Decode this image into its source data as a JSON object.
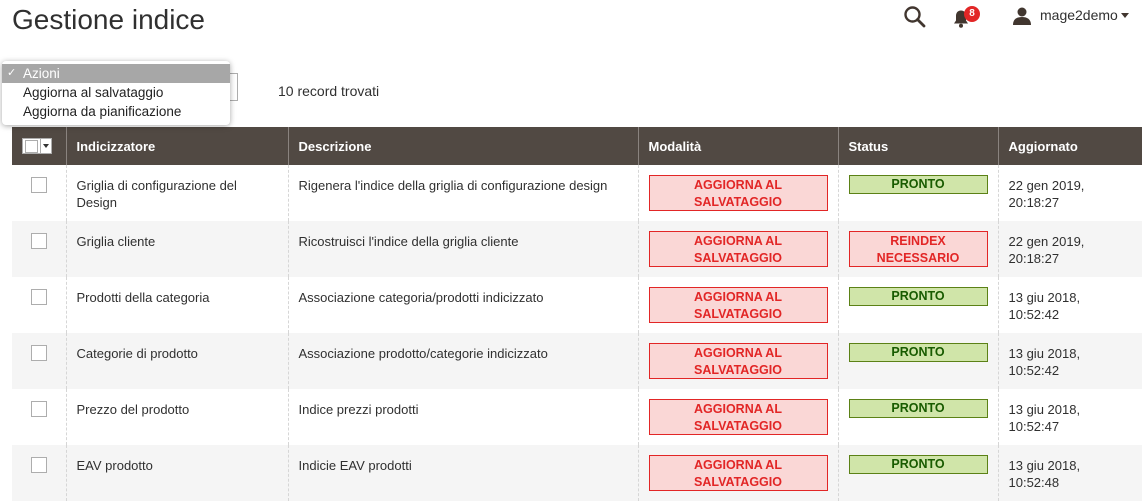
{
  "page": {
    "title": "Gestione indice"
  },
  "header": {
    "notifications_count": "8",
    "username": "mage2demo"
  },
  "actions_select": {
    "options": [
      "Azioni",
      "Aggiorna al salvataggio",
      "Aggiorna da pianificazione"
    ],
    "selected": "Azioni",
    "checkmark": "✓"
  },
  "records_found": "10 record trovati",
  "grid": {
    "columns": [
      "Indicizzatore",
      "Descrizione",
      "Modalità",
      "Status",
      "Aggiornato"
    ],
    "rows": [
      {
        "indexer": "Griglia di configurazione del Design",
        "description": "Rigenera l'indice della griglia di configurazione design",
        "mode": "AGGIORNA AL SALVATAGGIO",
        "status": "PRONTO",
        "status_type": "ok",
        "updated": "22 gen 2019, 20:18:27"
      },
      {
        "indexer": "Griglia cliente",
        "description": "Ricostruisci l'indice della griglia cliente",
        "mode": "AGGIORNA AL SALVATAGGIO",
        "status": "REINDEX NECESSARIO",
        "status_type": "critical",
        "updated": "22 gen 2019, 20:18:27"
      },
      {
        "indexer": "Prodotti della categoria",
        "description": "Associazione categoria/prodotti indicizzato",
        "mode": "AGGIORNA AL SALVATAGGIO",
        "status": "PRONTO",
        "status_type": "ok",
        "updated": "13 giu 2018, 10:52:42"
      },
      {
        "indexer": "Categorie di prodotto",
        "description": "Associazione prodotto/categorie indicizzato",
        "mode": "AGGIORNA AL SALVATAGGIO",
        "status": "PRONTO",
        "status_type": "ok",
        "updated": "13 giu 2018, 10:52:42"
      },
      {
        "indexer": "Prezzo del prodotto",
        "description": "Indice prezzi prodotti",
        "mode": "AGGIORNA AL SALVATAGGIO",
        "status": "PRONTO",
        "status_type": "ok",
        "updated": "13 giu 2018, 10:52:47"
      },
      {
        "indexer": "EAV prodotto",
        "description": "Indicie EAV prodotti",
        "mode": "AGGIORNA AL SALVATAGGIO",
        "status": "PRONTO",
        "status_type": "ok",
        "updated": "13 giu 2018, 10:52:48"
      }
    ]
  },
  "icons": {
    "search": "search-icon",
    "notifications": "bell-icon",
    "user": "user-icon"
  },
  "colors": {
    "header_bg": "#514943",
    "critical": "#e22626",
    "ok": "#185b00",
    "ok_bg": "#d0e5a9",
    "critical_bg": "#fad7d6"
  }
}
